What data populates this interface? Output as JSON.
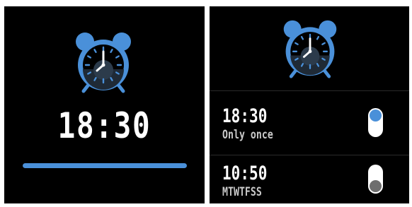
{
  "colors": {
    "accent": "#4a90d9",
    "background": "#000000",
    "text": "#ffffff",
    "knob_off": "#6e6e6e"
  },
  "left_screen": {
    "icon": "alarm-clock-icon",
    "time": "18:30",
    "progress": 1.0
  },
  "right_screen": {
    "icon": "alarm-clock-icon",
    "alarms": [
      {
        "time": "18:30",
        "repeat": "Only once",
        "enabled": true
      },
      {
        "time": "10:50",
        "repeat": "MTWTFSS",
        "enabled": false
      }
    ]
  }
}
